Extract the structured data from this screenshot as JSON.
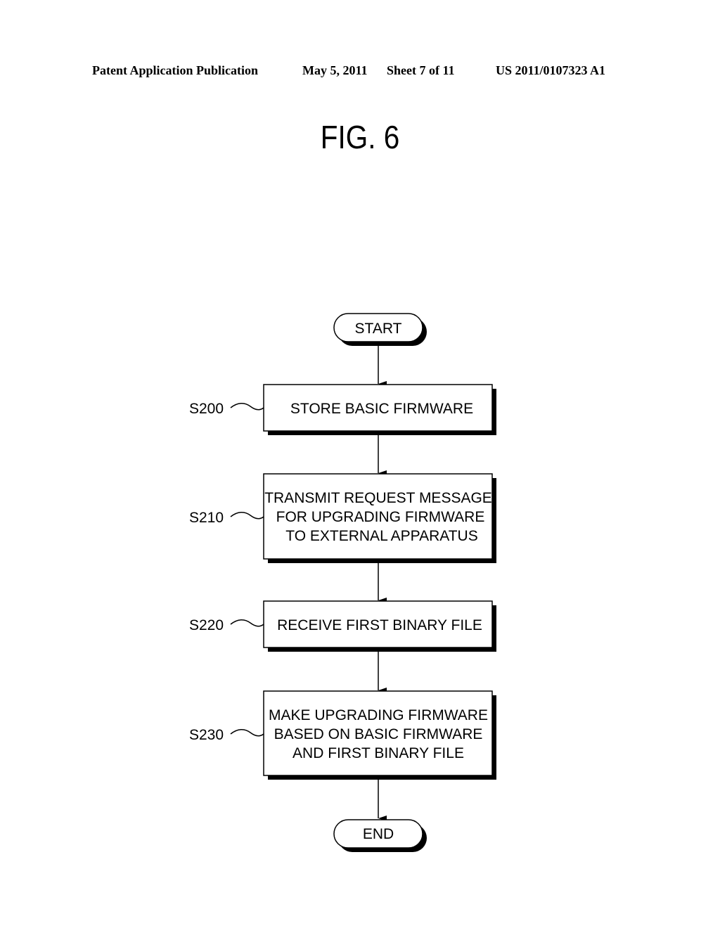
{
  "header": {
    "publication": "Patent Application Publication",
    "date": "May 5, 2011",
    "sheet": "Sheet 7 of 11",
    "number": "US 2011/0107323 A1"
  },
  "figure": {
    "title": "FIG. 6"
  },
  "flowchart": {
    "start": "START",
    "end": "END",
    "steps": [
      {
        "id": "S200",
        "lines": [
          "STORE BASIC FIRMWARE"
        ]
      },
      {
        "id": "S210",
        "lines": [
          "TRANSMIT REQUEST MESSAGE",
          "FOR UPGRADING FIRMWARE",
          "TO EXTERNAL APPARATUS"
        ]
      },
      {
        "id": "S220",
        "lines": [
          "RECEIVE FIRST BINARY FILE"
        ]
      },
      {
        "id": "S230",
        "lines": [
          "MAKE UPGRADING FIRMWARE",
          "BASED ON BASIC FIRMWARE",
          "AND FIRST BINARY FILE"
        ]
      }
    ]
  }
}
